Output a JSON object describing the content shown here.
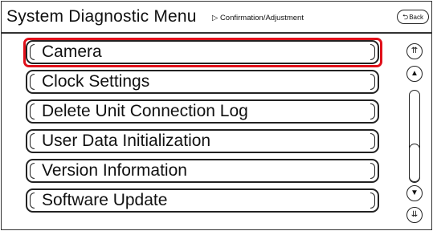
{
  "header": {
    "title": "System Diagnostic Menu",
    "breadcrumb": "▷ Confirmation/Adjustment",
    "back_label": "Back",
    "back_arrow": "⮌"
  },
  "menu": {
    "items": [
      {
        "label": "Camera",
        "selected": true
      },
      {
        "label": "Clock Settings",
        "selected": false
      },
      {
        "label": "Delete Unit Connection Log",
        "selected": false
      },
      {
        "label": "User Data Initialization",
        "selected": false
      },
      {
        "label": "Version Information",
        "selected": false
      },
      {
        "label": "Software Update",
        "selected": false
      }
    ]
  },
  "scroll": {
    "page_up_icon": "page-up-icon",
    "page_up_glyph": "⇈",
    "up_icon": "up-icon",
    "up_glyph": "▲",
    "down_icon": "down-icon",
    "down_glyph": "▼",
    "page_down_icon": "page-down-icon",
    "page_down_glyph": "⇊"
  },
  "colors": {
    "highlight": "#e0101a"
  }
}
